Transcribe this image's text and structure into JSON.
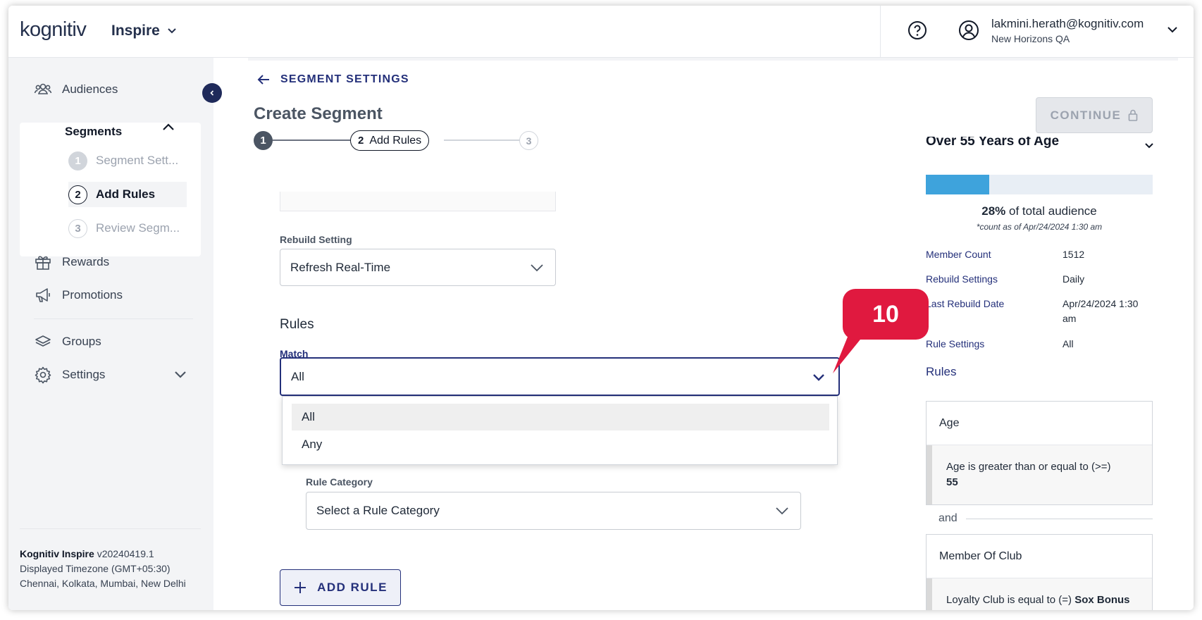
{
  "header": {
    "logo_main": "kognitiv",
    "product": "Inspire",
    "user_email": "lakmini.herath@kognitiv.com",
    "user_org": "New Horizons QA"
  },
  "sidebar": {
    "audiences": "Audiences",
    "segments": "Segments",
    "steps": [
      {
        "num": "1",
        "label": "Segment Sett..."
      },
      {
        "num": "2",
        "label": "Add Rules"
      },
      {
        "num": "3",
        "label": "Review Segm..."
      }
    ],
    "rewards": "Rewards",
    "promotions": "Promotions",
    "groups": "Groups",
    "settings": "Settings",
    "footer": {
      "app_name": "Kognitiv Inspire",
      "version": "v20240419.1",
      "timezone_line1": "Displayed Timezone (GMT+05:30)",
      "timezone_line2": "Chennai, Kolkata, Mumbai, New Delhi"
    }
  },
  "main": {
    "back_label": "SEGMENT SETTINGS",
    "title": "Create Segment",
    "stepper": {
      "step1": "1",
      "step2_num": "2",
      "step2_label": "Add Rules",
      "step3": "3"
    },
    "continue_label": "CONTINUE",
    "rebuild_label": "Rebuild Setting",
    "rebuild_value": "Refresh Real-Time",
    "rules_heading": "Rules",
    "match_label": "Match",
    "match_value": "All",
    "match_options": [
      "All",
      "Any"
    ],
    "rule_category_label": "Rule Category",
    "rule_category_placeholder": "Select a Rule Category",
    "add_rule_label": "ADD RULE"
  },
  "summary": {
    "title": "Over 55 Years of Age",
    "percent_value": 0.28,
    "percent_text": "28%",
    "percent_suffix": " of total audience",
    "count_note": "*count as of Apr/24/2024 1:30 am",
    "rows": [
      {
        "key": "Member Count",
        "value": "1512"
      },
      {
        "key": "Rebuild Settings",
        "value": "Daily"
      },
      {
        "key": "Last Rebuild Date",
        "value": "Apr/24/2024 1:30 am"
      },
      {
        "key": "Rule Settings",
        "value": "All"
      }
    ],
    "rules_heading": "Rules",
    "rule1": {
      "title": "Age",
      "text": "Age is greater than or equal to (>=)",
      "value": "55"
    },
    "and_label": "and",
    "rule2": {
      "title": "Member Of Club",
      "text": "Loyalty Club is equal to (=)",
      "value": "Sox Bonus Club"
    }
  },
  "callout": {
    "number": "10",
    "color": "#e0193f"
  },
  "colors": {
    "brand_navy": "#24307a",
    "accent_teal": "#1bb3b1",
    "progress": "#3ea3dc"
  }
}
